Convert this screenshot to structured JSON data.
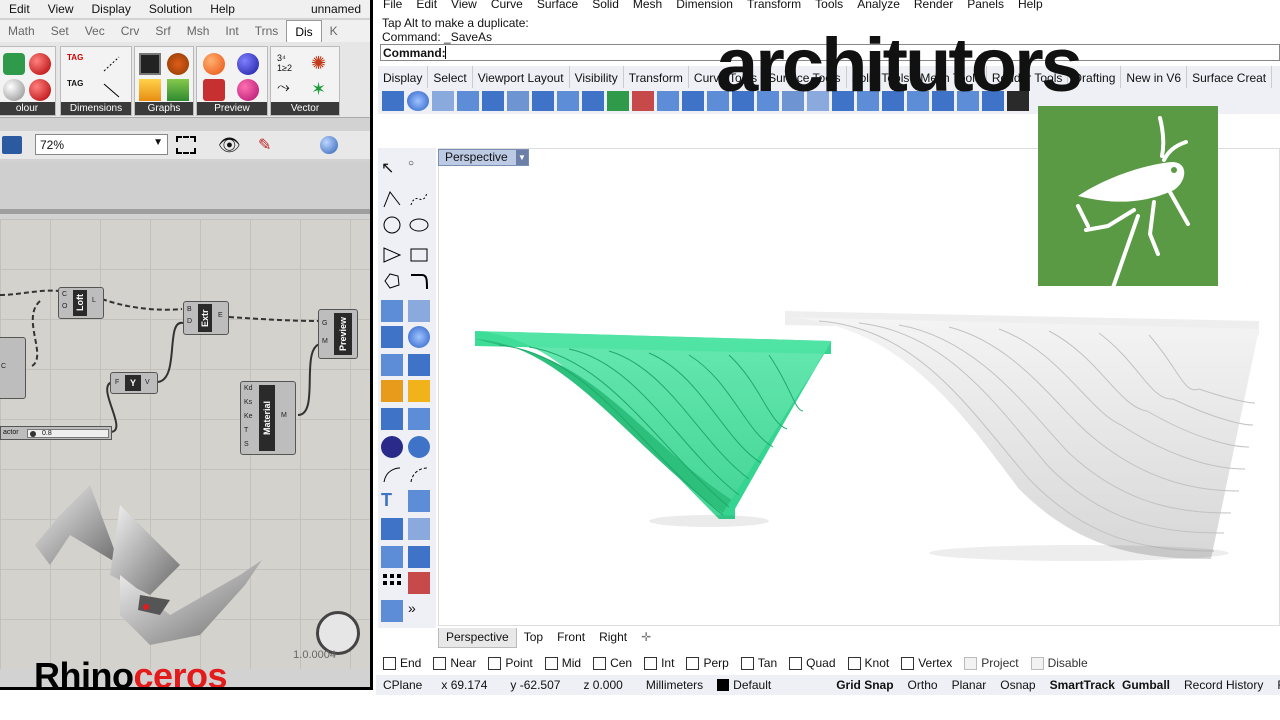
{
  "grasshopper": {
    "menu": [
      "Edit",
      "View",
      "Display",
      "Solution",
      "Help"
    ],
    "doc_title": "unnamed",
    "tabs": [
      "Math",
      "Set",
      "Vec",
      "Crv",
      "Srf",
      "Msh",
      "Int",
      "Trns",
      "Dis",
      "K"
    ],
    "active_tab": "Dis",
    "ribbon_groups": [
      "olour",
      "Dimensions",
      "Graphs",
      "Preview",
      "Vector"
    ],
    "zoom": "72%",
    "components": {
      "loft": {
        "name": "Loft",
        "in": [
          "C",
          "O"
        ],
        "out": "L"
      },
      "extrude": {
        "name": "Extr",
        "in": [
          "B",
          "D"
        ],
        "out": "E"
      },
      "vector": {
        "name": "Y",
        "in": "F",
        "out": "V"
      },
      "material": {
        "name": "Material",
        "in": [
          "Kd",
          "Ks",
          "Ke",
          "T",
          "S"
        ],
        "out": "M"
      },
      "preview": {
        "name": "Preview",
        "in": [
          "G",
          "M"
        ]
      },
      "slider": {
        "label": "actor",
        "value": "0.8"
      }
    },
    "version": "1.0.0004",
    "rhino_label_a": "Rhino",
    "rhino_label_b": "ceros"
  },
  "rhino": {
    "menu": [
      "File",
      "Edit",
      "View",
      "Curve",
      "Surface",
      "Solid",
      "Mesh",
      "Dimension",
      "Transform",
      "Tools",
      "Analyze",
      "Render",
      "Panels",
      "Help"
    ],
    "command_history": [
      "Tap Alt to make a duplicate:",
      "Command: _SaveAs"
    ],
    "command_prompt": "Command:",
    "toolbar_tabs": [
      "Display",
      "Select",
      "Viewport Layout",
      "Visibility",
      "Transform",
      "Curve Tools",
      "Surface Tools",
      "Solid Tools",
      "Mesh Tools",
      "Render Tools",
      "Drafting",
      "New in V6",
      "Surface Creat"
    ],
    "viewport_title": "Perspective",
    "viewport_tabs": [
      "Perspective",
      "Top",
      "Front",
      "Right"
    ],
    "osnaps": [
      {
        "label": "End",
        "checked": false
      },
      {
        "label": "Near",
        "checked": false
      },
      {
        "label": "Point",
        "checked": false
      },
      {
        "label": "Mid",
        "checked": false
      },
      {
        "label": "Cen",
        "checked": false
      },
      {
        "label": "Int",
        "checked": false
      },
      {
        "label": "Perp",
        "checked": false
      },
      {
        "label": "Tan",
        "checked": false
      },
      {
        "label": "Quad",
        "checked": false
      },
      {
        "label": "Knot",
        "checked": false
      },
      {
        "label": "Vertex",
        "checked": false
      },
      {
        "label": "Project",
        "checked": false
      },
      {
        "label": "Disable",
        "checked": false
      }
    ],
    "status": {
      "cplane": "CPlane",
      "x": "x 69.174",
      "y": "y -62.507",
      "z": "z 0.000",
      "units": "Millimeters",
      "layer": "Default",
      "toggles": [
        "Grid Snap",
        "Ortho",
        "Planar",
        "Osnap",
        "SmartTrack",
        "Gumball",
        "Record History",
        "Filter"
      ]
    }
  },
  "branding": {
    "logo_text": "architutors",
    "accent": "#5b9a45",
    "model_color_a": "#3ddc97",
    "model_color_b": "#e6e6e6"
  }
}
